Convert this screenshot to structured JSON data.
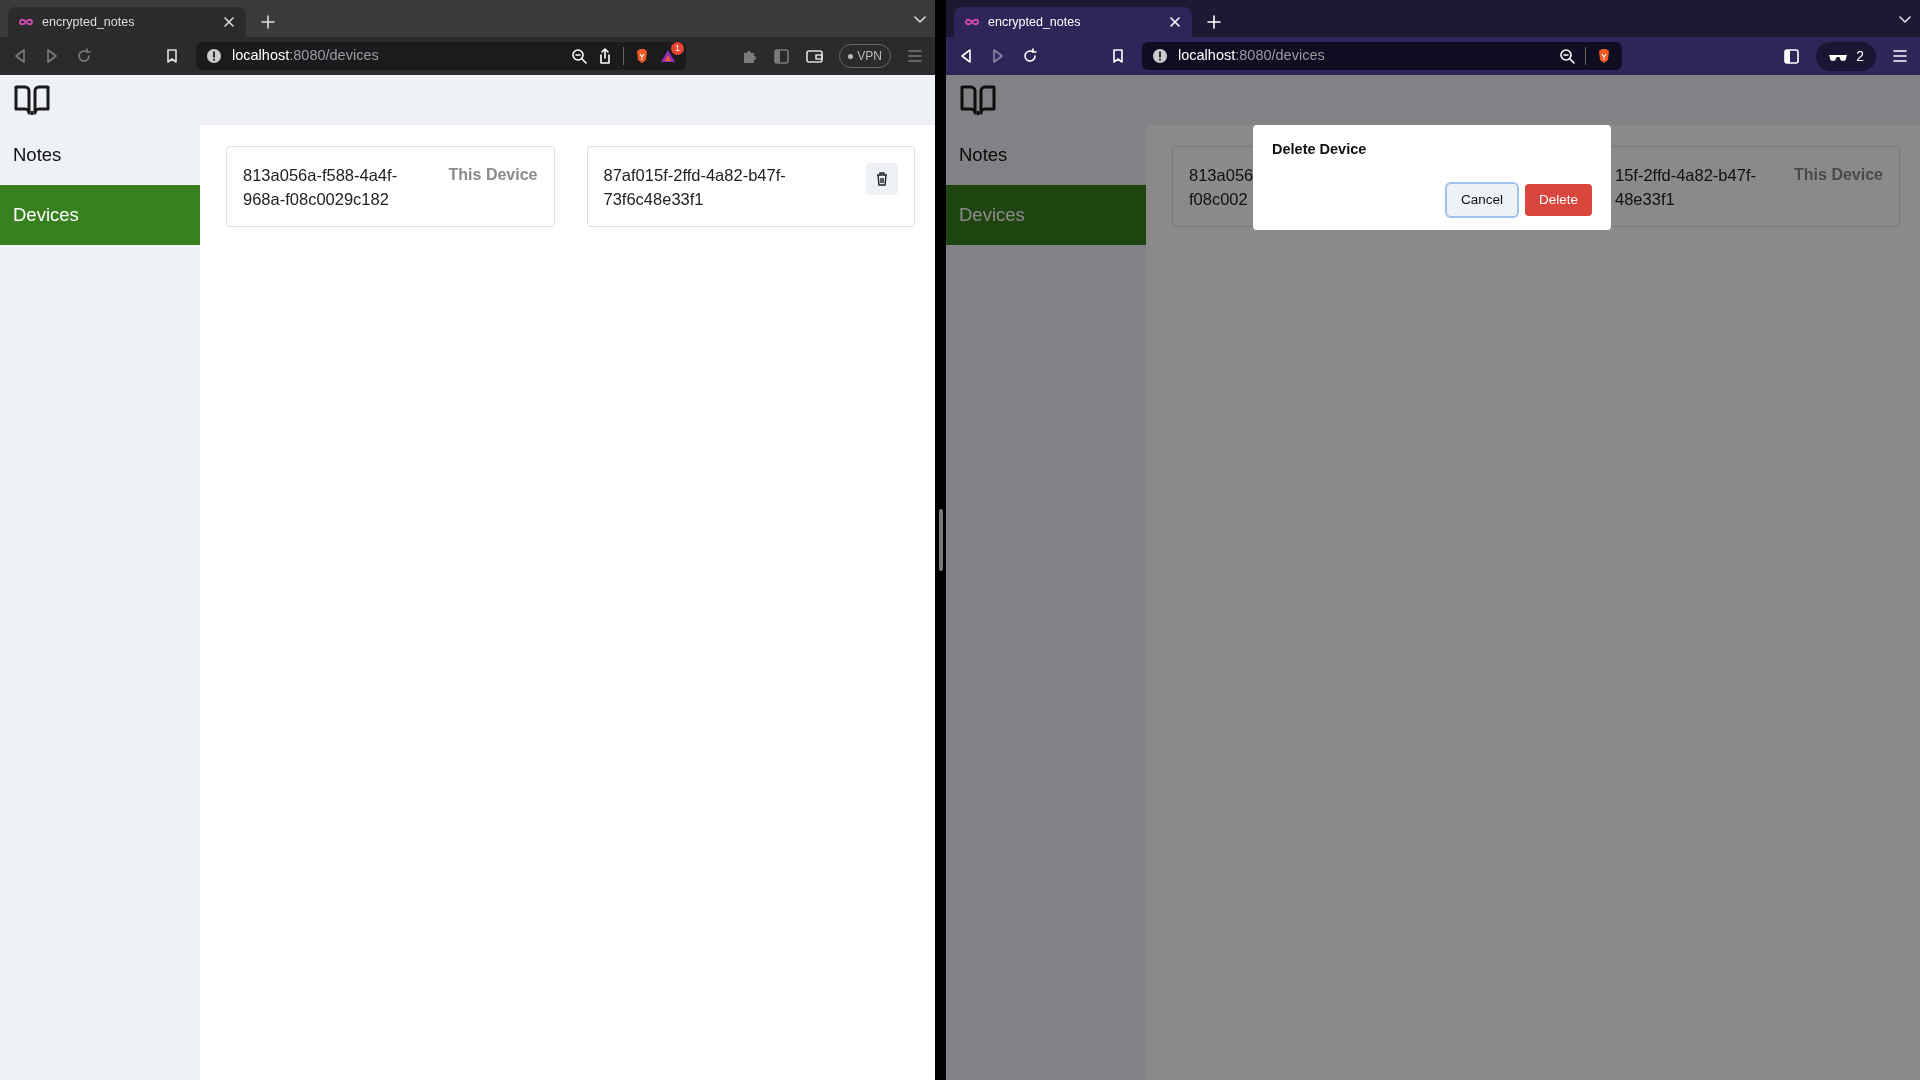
{
  "windows": [
    {
      "kind": "light",
      "focused": false,
      "tab": {
        "title": "encrypted_notes"
      },
      "address": {
        "host": "localhost",
        "path": ":8080/devices"
      },
      "rewards_badge": "1",
      "vpn_label": "VPN",
      "sidebar": {
        "items": [
          {
            "label": "Notes",
            "selected": false
          },
          {
            "label": "Devices",
            "selected": true
          }
        ]
      },
      "devices": [
        {
          "lines": [
            "813a056a-f588-4a4f-",
            "968a-f08c0029c182"
          ],
          "kind": "current",
          "tag": "This Device"
        },
        {
          "lines": [
            "87af015f-2ffd-4a82-b47f-",
            "73f6c48e33f1"
          ],
          "kind": "other"
        }
      ]
    },
    {
      "kind": "private",
      "focused": true,
      "tab": {
        "title": "encrypted_notes"
      },
      "address": {
        "host": "localhost",
        "path": ":8080/devices"
      },
      "private_count": "2",
      "sidebar": {
        "items": [
          {
            "label": "Notes",
            "selected": false
          },
          {
            "label": "Devices",
            "selected": true
          }
        ]
      },
      "devices": [
        {
          "lines": [
            "813a056",
            "f08c002"
          ],
          "kind": "covered-end"
        },
        {
          "lines": [
            "15f-2ffd-4a82-b47f-",
            "48e33f1"
          ],
          "kind": "covered-start",
          "tag": "This Device"
        }
      ],
      "dialog": {
        "title": "Delete Device",
        "buttons": [
          {
            "label": "Cancel",
            "kind": "secondary"
          },
          {
            "label": "Delete",
            "kind": "danger"
          }
        ]
      }
    }
  ]
}
